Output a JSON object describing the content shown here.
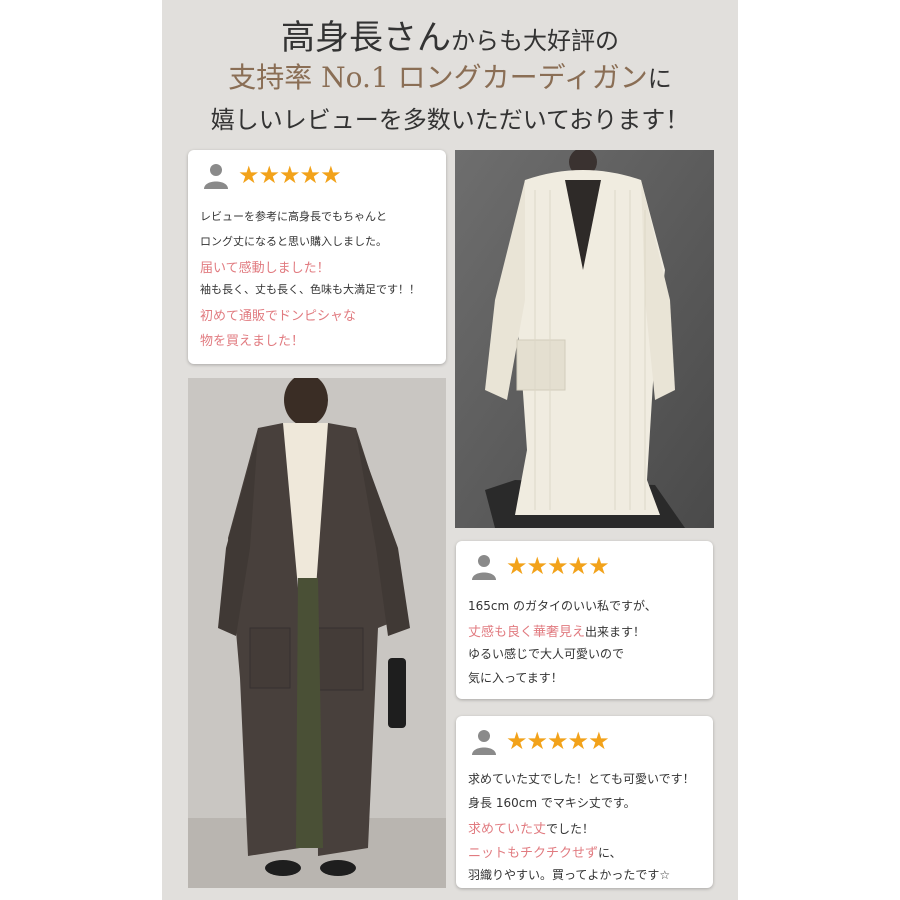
{
  "headline": {
    "line1": {
      "part1": "高身長さん",
      "part2": "からも大好評の"
    },
    "line2": {
      "part1": "支持率 No.1 ロングカーディガン",
      "part2": "に"
    },
    "line3": "嬉しいレビューを多数いただいております！"
  },
  "reviews": [
    {
      "stars": "★★★★★",
      "lines": [
        {
          "type": "s",
          "text": "レビューを参考に高身長でもちゃんと"
        },
        {
          "type": "s",
          "text": "ロング丈になると思い購入しました。"
        },
        {
          "type": "pk",
          "text": "届いて感動しました！"
        },
        {
          "type": "s",
          "text": "袖も長く、丈も長く、色味も大満足です！！"
        },
        {
          "type": "pk",
          "text": "初めて通販でドンピシャな"
        },
        {
          "type": "pk",
          "text": "物を買えました！"
        }
      ]
    },
    {
      "stars": "★★★★★",
      "lines": [
        {
          "type": "m",
          "text": "165cm のガタイのいい私ですが、"
        },
        {
          "type": "mixed",
          "pink": "丈感も良く華奢見え",
          "rest": "出来ます！"
        },
        {
          "type": "m",
          "text": "ゆるい感じで大人可愛いので"
        },
        {
          "type": "m",
          "text": "気に入ってます！"
        }
      ]
    },
    {
      "stars": "★★★★★",
      "lines": [
        {
          "type": "m",
          "text": "求めていた丈でした！とても可愛いです！"
        },
        {
          "type": "m",
          "text": "身長 160cm でマキシ丈です。"
        },
        {
          "type": "mixed",
          "pink": "求めていた丈",
          "rest": "でした！"
        },
        {
          "type": "mixed",
          "pink": "ニットもチクチクせず",
          "rest": "に、"
        },
        {
          "type": "m",
          "text": "羽織りやすい。買ってよかったです☆"
        }
      ]
    }
  ],
  "icons": {
    "user": "user-icon",
    "star": "star-icon"
  },
  "colors": {
    "accent_star": "#f2a21a",
    "accent_pink": "#e17b80",
    "headline_brown": "#8a6e55",
    "panel_bg": "#e1dfdc"
  }
}
